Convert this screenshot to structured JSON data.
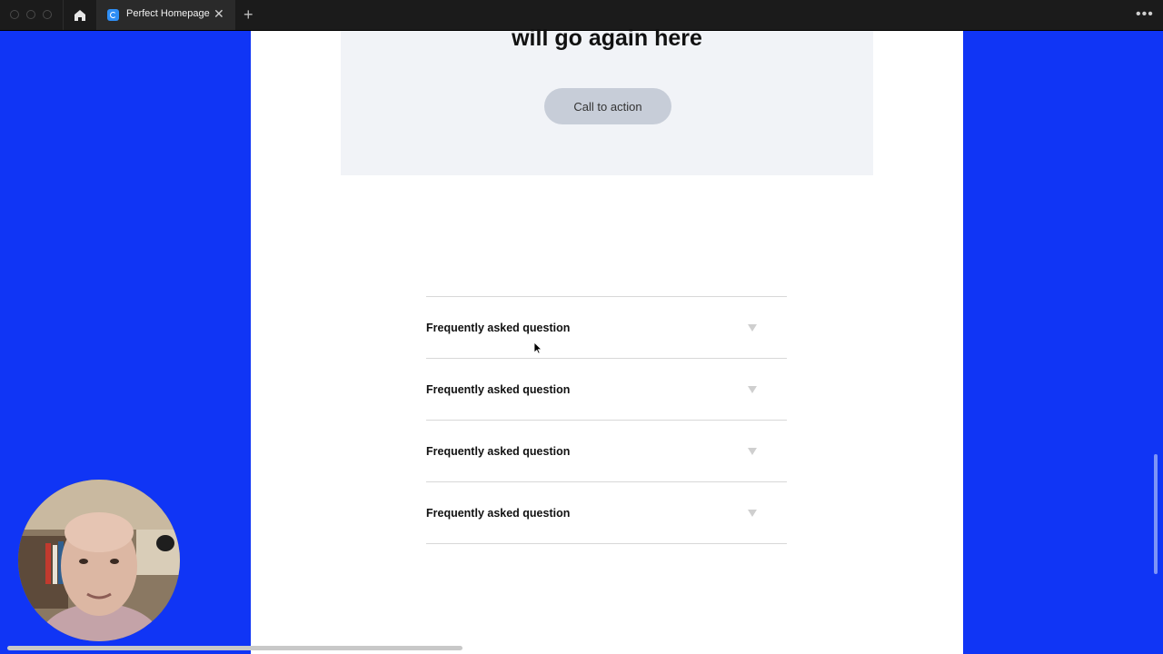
{
  "window": {
    "tab_title": "Perfect Homepage",
    "tab_close": "✕",
    "new_tab": "+",
    "more": "•••"
  },
  "cta": {
    "heading": "will go again here",
    "button_label": "Call to action"
  },
  "faq": {
    "items": [
      {
        "question": "Frequently asked question"
      },
      {
        "question": "Frequently asked question"
      },
      {
        "question": "Frequently asked question"
      },
      {
        "question": "Frequently asked question"
      }
    ]
  },
  "colors": {
    "canvas_bg": "#1035f5",
    "cta_bg": "#f1f3f7",
    "button_bg": "#c7cdd8"
  },
  "icons": {
    "home": "home-icon",
    "faq_toggle": "chevron-down-icon"
  }
}
